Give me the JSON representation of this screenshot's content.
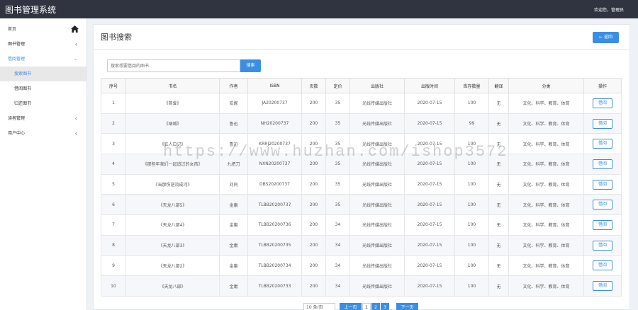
{
  "app": {
    "title": "图书管理系统",
    "user_greeting": "欢迎您，管理员"
  },
  "sidebar": {
    "items": [
      {
        "label": "首页",
        "icon": "home-icon"
      },
      {
        "label": "图书管理",
        "icon": "chevron-left-icon"
      },
      {
        "label": "借阅管理",
        "icon": "chevron-down-icon"
      },
      {
        "label": "搜索图书"
      },
      {
        "label": "借阅图书"
      },
      {
        "label": "归还图书"
      },
      {
        "label": "读者管理",
        "icon": "chevron-left-icon"
      },
      {
        "label": "用户中心",
        "icon": "chevron-left-icon"
      }
    ]
  },
  "panel": {
    "title": "图书搜索",
    "back_label": "← 返回",
    "search_placeholder": "搜索想要借阅的图书",
    "search_label": "搜索"
  },
  "table": {
    "headers": [
      "序号",
      "书名",
      "作者",
      "ISBN",
      "页数",
      "定价",
      "出版社",
      "出版时间",
      "库存数量",
      "翻译",
      "分类",
      "操作"
    ],
    "action_label": "借阅",
    "rows": [
      [
        "1",
        "《简爱》",
        "安妮",
        "JA20200737",
        "200",
        "35",
        "光线传媒出版社",
        "2020-07-15",
        "100",
        "无",
        "文化、科学、教育、体育"
      ],
      [
        "2",
        "《呐喊》",
        "鲁迅",
        "NH20200737",
        "200",
        "35",
        "光线传媒出版社",
        "2020-07-15",
        "99",
        "无",
        "文化、科学、教育、体育"
      ],
      [
        "3",
        "《狂人日记》",
        "鲁迅",
        "KRRJ20200737",
        "200",
        "35",
        "光线传媒出版社",
        "2020-07-15",
        "100",
        "无",
        "文化、科学、教育、体育"
      ],
      [
        "4",
        "《那些年我们一起追过的女孩》",
        "九把刀",
        "NXN20200737",
        "200",
        "35",
        "光线传媒出版社",
        "2020-07-15",
        "100",
        "无",
        "文化、科学、教育、体育"
      ],
      [
        "5",
        "《当那伤逆流成河》",
        "刘同",
        "DBS20200737",
        "200",
        "35",
        "光线传媒出版社",
        "2020-07-15",
        "100",
        "无",
        "文化、科学、教育、体育"
      ],
      [
        "6",
        "《天龙八部5》",
        "金庸",
        "TLBB20200737",
        "200",
        "35",
        "光线传媒出版社",
        "2020-07-15",
        "100",
        "无",
        "文化、科学、教育、体育"
      ],
      [
        "7",
        "《天龙八部4》",
        "金庸",
        "TLBB20200736",
        "200",
        "34",
        "光线传媒出版社",
        "2020-07-15",
        "100",
        "无",
        "文化、科学、教育、体育"
      ],
      [
        "8",
        "《天龙八部3》",
        "金庸",
        "TLBB20200735",
        "200",
        "34",
        "光线传媒出版社",
        "2020-07-15",
        "100",
        "无",
        "文化、科学、教育、体育"
      ],
      [
        "9",
        "《天龙八部2》",
        "金庸",
        "TLBB20200734",
        "200",
        "34",
        "光线传媒出版社",
        "2020-07-15",
        "100",
        "无",
        "文化、科学、教育、体育"
      ],
      [
        "10",
        "《天龙八部》",
        "金庸",
        "TLBB20200733",
        "200",
        "34",
        "光线传媒出版社",
        "2020-07-15",
        "100",
        "无",
        "文化、科学、教育、体育"
      ]
    ]
  },
  "pagination": {
    "page_size": "10 条/页",
    "prev": "上一页",
    "pages": [
      "1",
      "2",
      "3"
    ],
    "next": "下一页"
  },
  "watermark": "https://www.huzhan.com/ishop3572",
  "colors": {
    "accent": "#3a8ee6",
    "topbar": "#2f3440"
  }
}
